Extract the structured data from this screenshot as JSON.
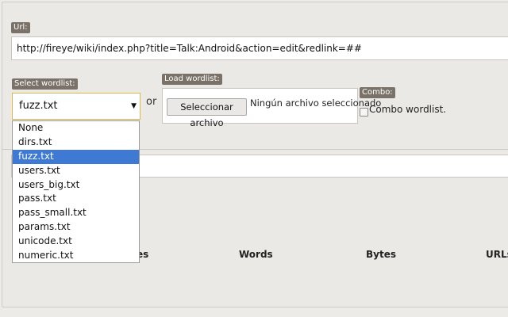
{
  "url": {
    "label": "Url:",
    "value": "http://fireye/wiki/index.php?title=Talk:Android&action=edit&redlink=##"
  },
  "wordlist": {
    "label": "Select wordlist:",
    "selected": "fuzz.txt",
    "arrow": "▼",
    "options": [
      "None",
      "dirs.txt",
      "fuzz.txt",
      "users.txt",
      "users_big.txt",
      "pass.txt",
      "pass_small.txt",
      "params.txt",
      "unicode.txt",
      "numeric.txt"
    ]
  },
  "or_text": "or",
  "load": {
    "label": "Load wordlist:",
    "button": "Seleccionar archivo",
    "status": "Ningún archivo seleccionado"
  },
  "combo": {
    "label": "Combo:",
    "checkbox_label": "Combo wordlist."
  },
  "results_headers": {
    "partial": "es",
    "words": "Words",
    "bytes": "Bytes",
    "urls": "URLs"
  },
  "colors": {
    "label_bg": "#7a7268",
    "select_border": "#d9b84a",
    "selected_option": "#3e79d4"
  }
}
